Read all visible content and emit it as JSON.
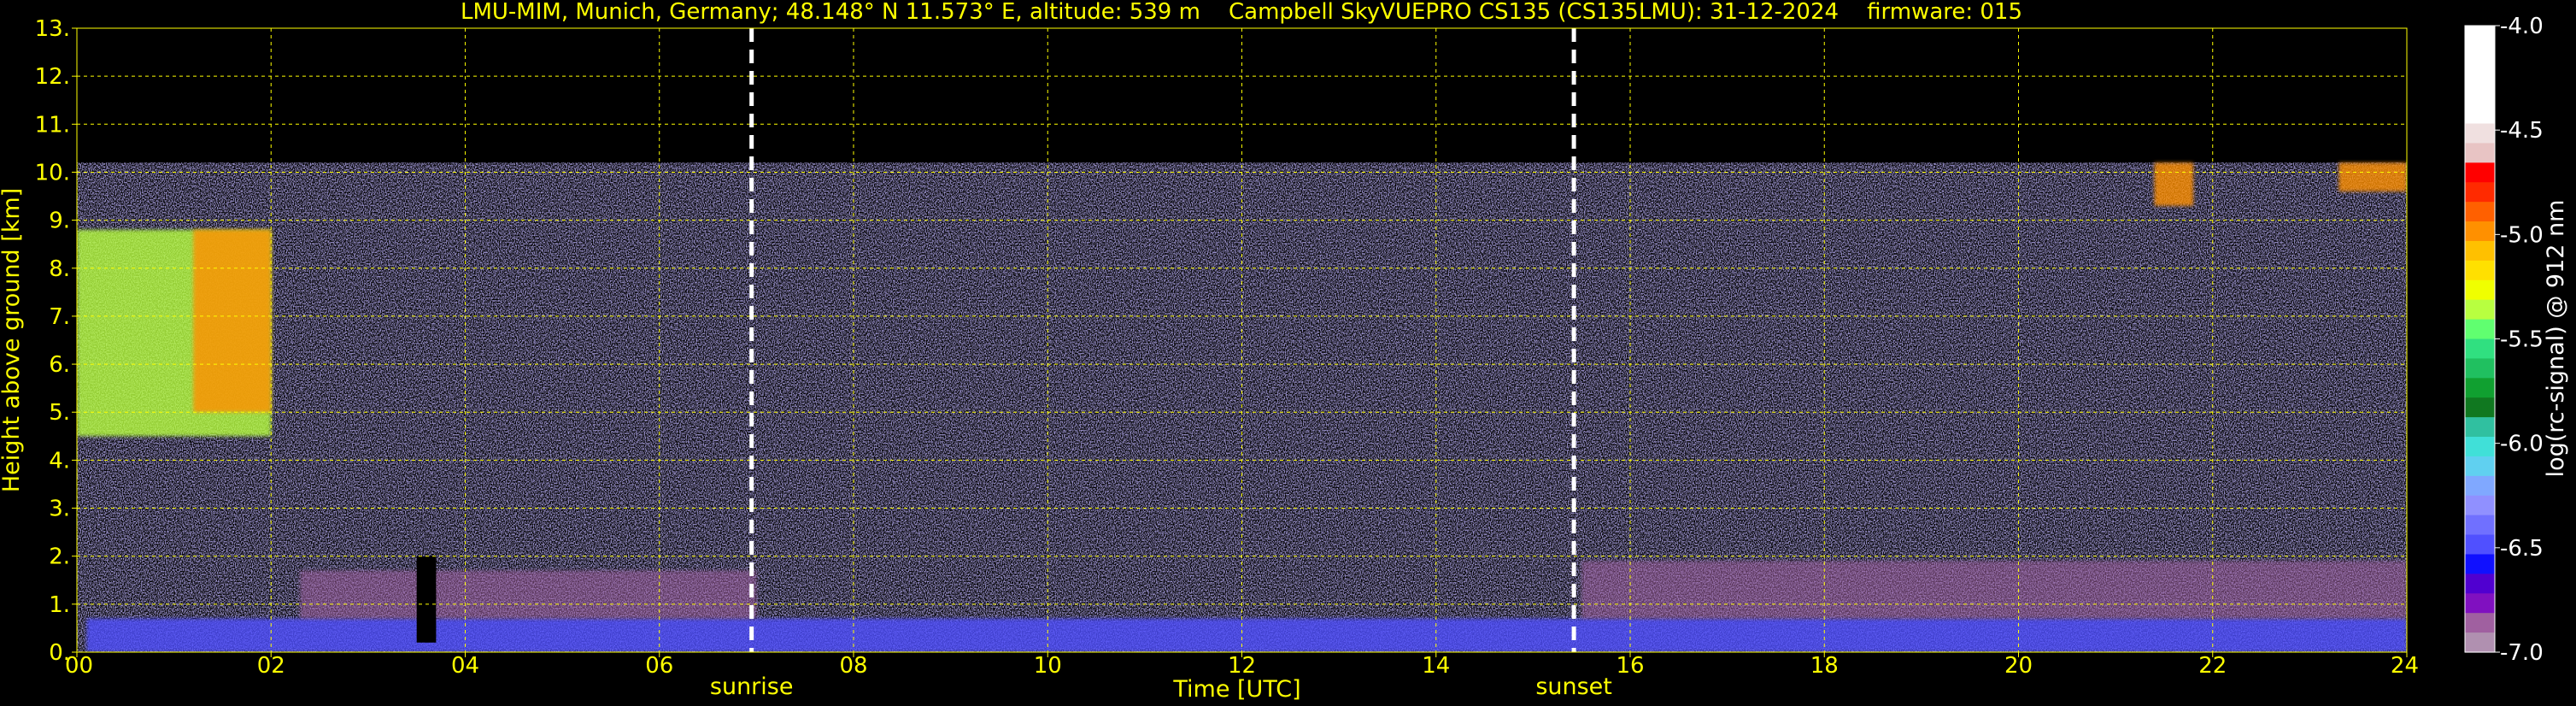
{
  "chart_data": {
    "type": "heatmap",
    "title": "LMU-MIM, Munich, Germany; 48.148° N 11.573° E, altitude: 539 m    Campbell SkyVUEPRO CS135 (CS135LMU): 31-12-2024    firmware: 015",
    "xlabel": "Time [UTC]",
    "ylabel": "Height above ground [km]",
    "xlim": [
      0,
      24
    ],
    "ylim": [
      0,
      13
    ],
    "x_ticks": [
      0,
      2,
      4,
      6,
      8,
      10,
      12,
      14,
      16,
      18,
      20,
      22,
      24
    ],
    "x_tick_labels": [
      "00",
      "02",
      "04",
      "06",
      "08",
      "10",
      "12",
      "14",
      "16",
      "18",
      "20",
      "22",
      "24"
    ],
    "y_ticks": [
      0,
      1,
      2,
      3,
      4,
      5,
      6,
      7,
      8,
      9,
      10,
      11,
      12,
      13
    ],
    "y_tick_labels": [
      "0.",
      "1.",
      "2.",
      "3.",
      "4.",
      "5.",
      "6.",
      "7.",
      "8.",
      "9.",
      "10.",
      "11.",
      "12.",
      "13."
    ],
    "grid": true,
    "data_top_km": 10.2,
    "markers": [
      {
        "label": "sunrise",
        "x": 6.95
      },
      {
        "label": "sunset",
        "x": 15.42
      }
    ],
    "colorbar": {
      "label": "log(rc-signal) @ 912 nm",
      "range": [
        -7.0,
        -4.0
      ],
      "ticks": [
        -4.0,
        -4.5,
        -5.0,
        -5.5,
        -6.0,
        -6.5,
        -7.0
      ],
      "tick_labels": [
        "-4.0",
        "-4.5",
        "-5.0",
        "-5.5",
        "-6.0",
        "-6.5",
        "-7.0"
      ],
      "colors": [
        "#ffffff",
        "#ffffff",
        "#ffffff",
        "#ffffff",
        "#ffffff",
        "#f0e0e0",
        "#e8c4c4",
        "#ff0000",
        "#ff2a00",
        "#ff6000",
        "#ff9000",
        "#ffc000",
        "#ffe000",
        "#f0ff00",
        "#b8ff40",
        "#60ff70",
        "#30e080",
        "#20c060",
        "#10a030",
        "#107820",
        "#30c0a0",
        "#40e0d8",
        "#60d0f0",
        "#80a8ff",
        "#9090ff",
        "#7070ff",
        "#5050ff",
        "#1010ff",
        "#5000d0",
        "#8010c0",
        "#a060a0",
        "#b090b0"
      ]
    },
    "signal_regions": [
      {
        "name": "cloud",
        "t_start": 0,
        "t_end": 2.0,
        "h_bottom": 4.5,
        "h_top": 8.8,
        "level": -5.4
      },
      {
        "name": "cloud-core",
        "t_start": 1.2,
        "t_end": 2.0,
        "h_bottom": 5.0,
        "h_top": 8.8,
        "level": -5.0
      },
      {
        "name": "cloud",
        "t_start": 21.4,
        "t_end": 21.8,
        "h_bottom": 9.3,
        "h_top": 10.2,
        "level": -5.0
      },
      {
        "name": "cloud",
        "t_start": 23.3,
        "t_end": 24.0,
        "h_bottom": 9.6,
        "h_top": 10.2,
        "level": -5.0
      },
      {
        "name": "boundary-layer",
        "t_start": 0.1,
        "t_end": 24.0,
        "h_bottom": 0.0,
        "h_top": 0.7,
        "level": -6.5
      },
      {
        "name": "aerosol",
        "t_start": 2.3,
        "t_end": 7.0,
        "h_bottom": 0.7,
        "h_top": 1.7,
        "level": -6.9
      },
      {
        "name": "aerosol",
        "t_start": 15.5,
        "t_end": 24.0,
        "h_bottom": 0.7,
        "h_top": 1.9,
        "level": -6.9
      },
      {
        "name": "data-gap",
        "t_start": 3.5,
        "t_end": 3.7,
        "h_bottom": 0.2,
        "h_top": 2.0,
        "level": null
      }
    ]
  }
}
